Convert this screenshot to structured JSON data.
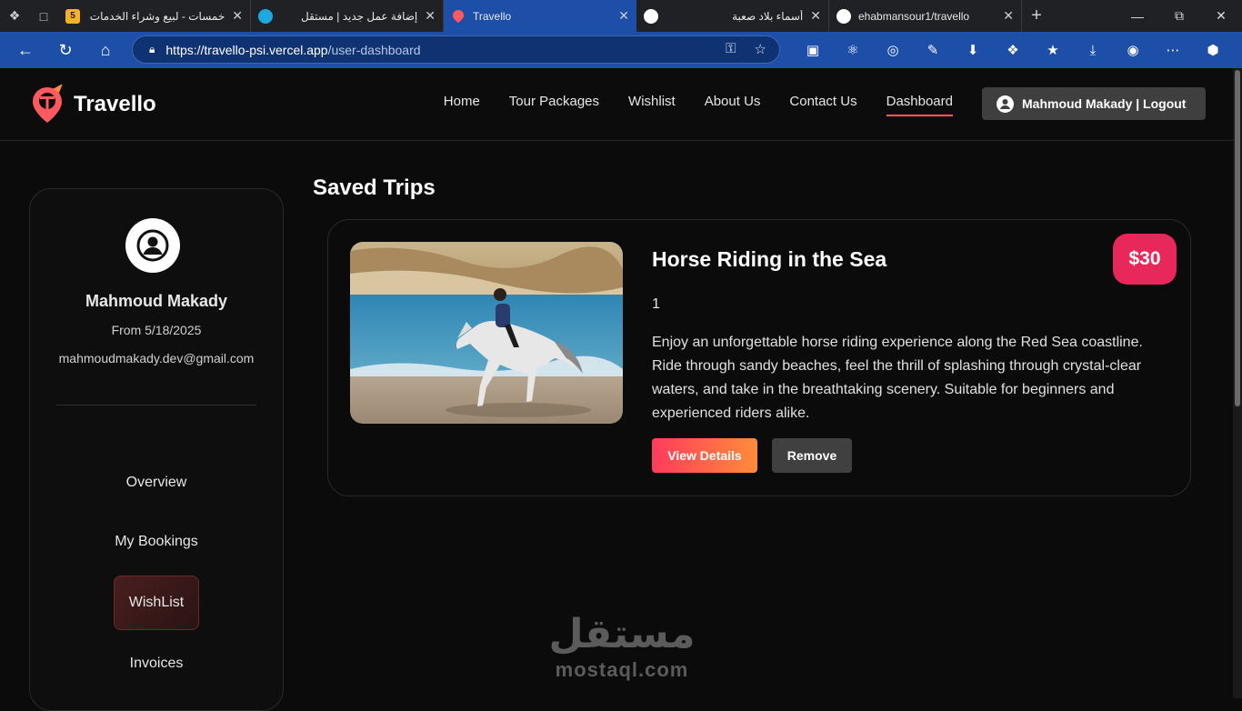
{
  "browser": {
    "tabs": [
      {
        "title": "خمسات - لبيع وشراء الخدمات",
        "favicon": "5"
      },
      {
        "title": "إضافة عمل جديد | مستقل",
        "favicon": ""
      },
      {
        "title": "Travello",
        "favicon": "travello",
        "active": true
      },
      {
        "title": "أسماء بلاد صعبة",
        "favicon": ""
      },
      {
        "title": "ehabmansour1/travello",
        "favicon": "github"
      }
    ],
    "url_host": "https://travello-psi.vercel.app",
    "url_path": "/user-dashboard"
  },
  "site": {
    "brand": "Travello",
    "nav": [
      "Home",
      "Tour Packages",
      "Wishlist",
      "About Us",
      "Contact Us",
      "Dashboard"
    ],
    "active_nav": "Dashboard",
    "user_button": "Mahmoud Makady | Logout"
  },
  "sidebar": {
    "name": "Mahmoud Makady",
    "from": "From 5/18/2025",
    "email": "mahmoudmakady.dev@gmail.com",
    "items": [
      "Overview",
      "My Bookings",
      "WishList",
      "Invoices"
    ],
    "active_item": "WishList"
  },
  "main": {
    "title": "Saved Trips",
    "trip": {
      "title": "Horse Riding in the Sea",
      "price": "$30",
      "count": "1",
      "description": "Enjoy an unforgettable horse riding experience along the Red Sea coastline. Ride through sandy beaches, feel the thrill of splashing through crystal-clear waters, and take in the breathtaking scenery. Suitable for beginners and experienced riders alike.",
      "view_label": "View Details",
      "remove_label": "Remove"
    }
  },
  "watermark": {
    "arabic": "مستقل",
    "latin": "mostaql.com"
  },
  "colors": {
    "accent": "#ff5a5f",
    "price_bg": "#e8285a",
    "browser_blue": "#1d4ea8"
  }
}
